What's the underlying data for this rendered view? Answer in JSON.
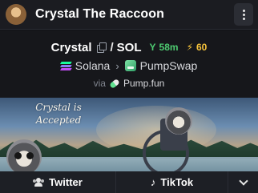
{
  "header": {
    "title": "Crystal The Raccoon",
    "logo_icon": "raccoon-avatar",
    "menu_icon": "vertical-dots-icon"
  },
  "pair": {
    "base_symbol": "Crystal",
    "separator": "/",
    "quote_symbol": "SOL",
    "age": "58m",
    "boosts": "60",
    "age_color": "#4ecb71",
    "boost_color": "#f6c33b"
  },
  "chain": {
    "name": "Solana",
    "dex": "PumpSwap"
  },
  "launch": {
    "via_label": "via",
    "launchpad": "Pump.fun"
  },
  "banner": {
    "caption": "Crystal is Accepted"
  },
  "socials": {
    "items": [
      {
        "label": "Twitter",
        "icon": "users-icon"
      },
      {
        "label": "TikTok",
        "icon": "tiktok-icon"
      }
    ],
    "more_icon": "chevron-down-icon"
  }
}
